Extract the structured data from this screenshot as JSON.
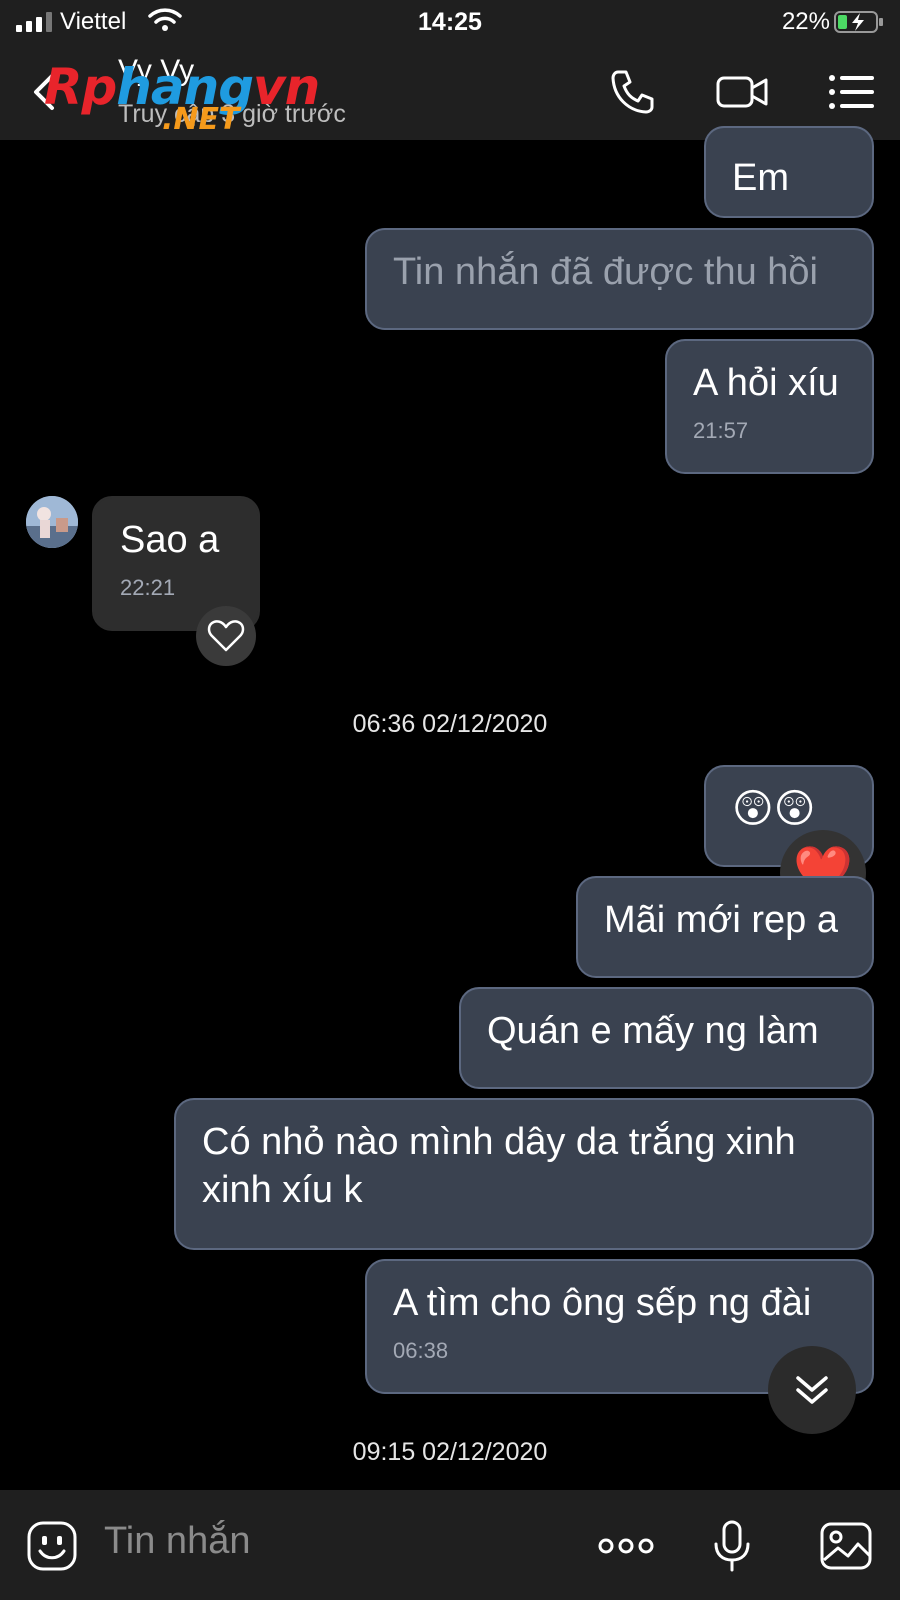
{
  "status_bar": {
    "carrier": "Viettel",
    "time": "14:25",
    "battery_percent": "22%"
  },
  "header": {
    "contact_name": "Vy Vy",
    "last_seen": "Truy cập 3 giờ trước",
    "watermark": {
      "text_main": "Rphangvn",
      "text_tld": ".NET"
    },
    "icons": [
      "back-arrow-icon",
      "phone-icon",
      "video-call-icon",
      "menu-list-icon"
    ]
  },
  "messages": [
    {
      "side": "out",
      "text": "Em",
      "time": ""
    },
    {
      "side": "out",
      "text": "Tin nhắn đã được thu hồi",
      "time": "",
      "recalled": true
    },
    {
      "side": "out",
      "text": "A hỏi xíu",
      "time": "21:57"
    },
    {
      "side": "in",
      "text": "Sao a",
      "time": "22:21"
    },
    {
      "side": "out",
      "text": "😲😲",
      "time": ""
    },
    {
      "side": "out",
      "text": "Mãi mới rep a",
      "time": ""
    },
    {
      "side": "out",
      "text": "Quán e mấy ng làm",
      "time": ""
    },
    {
      "side": "out",
      "text": "Có nhỏ nào mình dây da trắng xinh xinh xíu k",
      "time": ""
    },
    {
      "side": "out",
      "text": "A tìm cho ông sếp ng đài",
      "time": "06:38"
    }
  ],
  "date_separators": [
    "06:36 02/12/2020",
    "09:15 02/12/2020"
  ],
  "reactions": {
    "heart_emoji": "❤️"
  },
  "input": {
    "placeholder": "Tin nhắn"
  },
  "colors": {
    "outgoing_bubble": "#3a4250",
    "outgoing_border": "#5c6880",
    "incoming_bubble": "#2d2d2d",
    "background": "#000000",
    "bar": "#1f1f1f"
  }
}
